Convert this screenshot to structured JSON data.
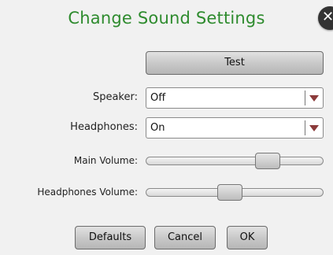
{
  "dialog": {
    "title": "Change Sound Settings",
    "close_icon": "close-icon",
    "accent_color": "#2e8b2e"
  },
  "test_button": {
    "label": "Test"
  },
  "speaker": {
    "label": "Speaker:",
    "value": "Off"
  },
  "headphones": {
    "label": "Headphones:",
    "value": "On"
  },
  "main_volume": {
    "label": "Main Volume:",
    "level": 0.72
  },
  "headphones_volume": {
    "label": "Headphones Volume:",
    "level": 0.47
  },
  "footer": {
    "defaults_label": "Defaults",
    "cancel_label": "Cancel",
    "ok_label": "OK"
  }
}
